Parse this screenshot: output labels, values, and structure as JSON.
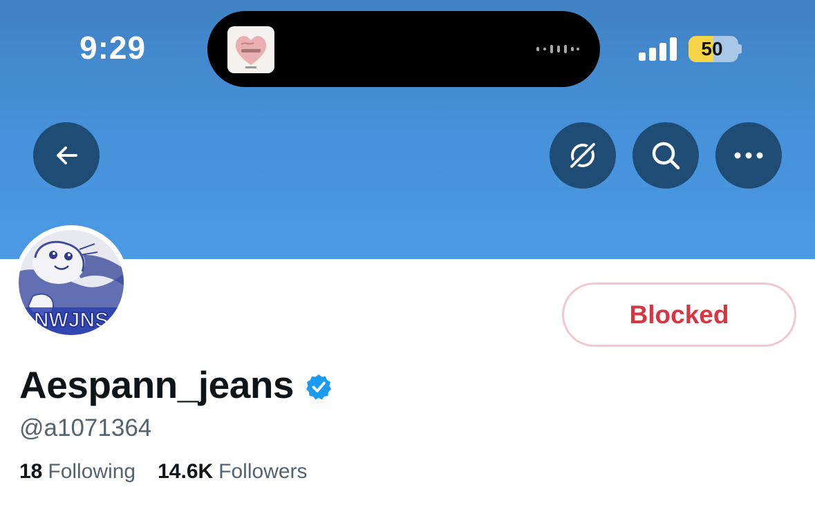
{
  "status_bar": {
    "time": "9:29",
    "battery_level": "50",
    "battery_fraction": 0.5,
    "now_playing_icon": "album-art-icon",
    "signal_icon": "cellular-signal-icon",
    "colors": {
      "battery_fill": "#f5d547"
    }
  },
  "header": {
    "back_icon": "arrow-left-icon",
    "grok_icon": "grok-icon",
    "search_icon": "search-icon",
    "more_icon": "more-horizontal-icon",
    "colors": {
      "banner": "#4792da",
      "button_bg": "#1e4c75"
    }
  },
  "profile": {
    "avatar_text": "NWJNS",
    "follow_button_label": "Blocked",
    "display_name": "Aespann_jeans",
    "verified_icon": "verified-badge-icon",
    "handle": "@a1071364",
    "following_count": "18",
    "following_label": "Following",
    "followers_count": "14.6K",
    "followers_label": "Followers",
    "colors": {
      "blocked_text": "#d9343f",
      "verified": "#1d9bf0"
    }
  }
}
